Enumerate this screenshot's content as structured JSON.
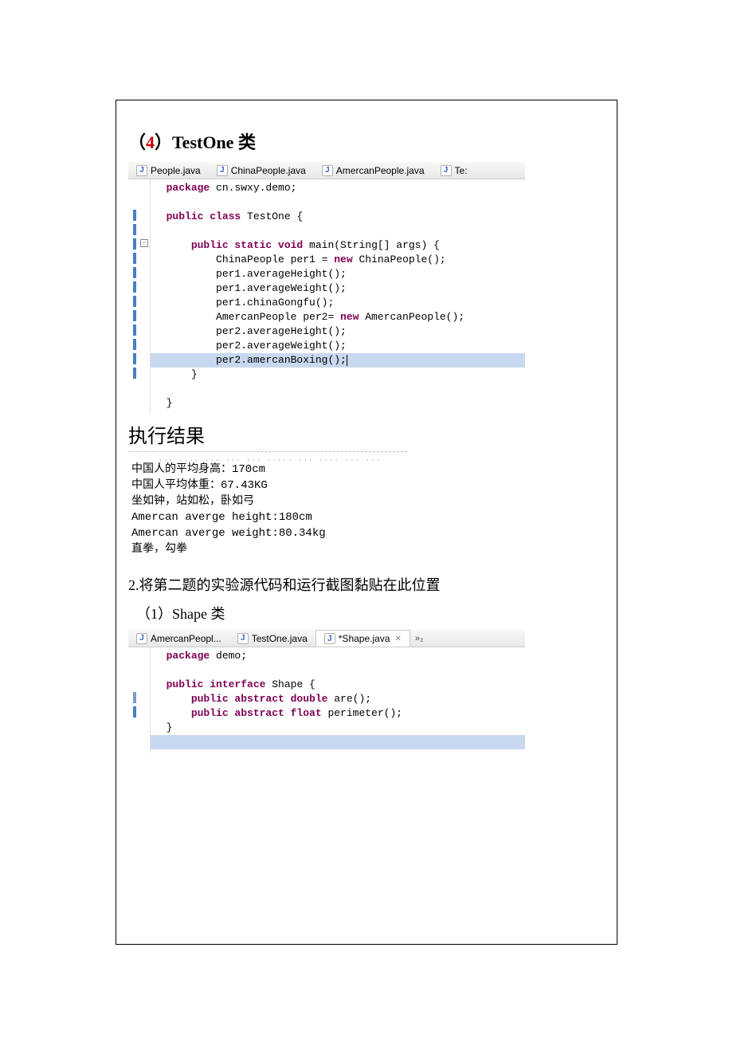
{
  "section4": {
    "title_paren_open": "（",
    "title_num": "4",
    "title_paren_close": "）",
    "title_name": "TestOne",
    "title_class_word": " 类"
  },
  "tabs1": [
    {
      "label": "People.java",
      "active": false
    },
    {
      "label": "ChinaPeople.java",
      "active": false
    },
    {
      "label": "AmercanPeople.java",
      "active": false
    },
    {
      "label": "Te:",
      "active": false
    }
  ],
  "code1_lines": [
    {
      "indent": "  ",
      "tokens": [
        {
          "t": "kw",
          "v": "package"
        },
        {
          "t": "plain",
          "v": " cn.swxy.demo;"
        }
      ],
      "gutter": {}
    },
    {
      "indent": "",
      "tokens": [],
      "gutter": {}
    },
    {
      "indent": "  ",
      "tokens": [
        {
          "t": "kw",
          "v": "public class"
        },
        {
          "t": "plain",
          "v": " TestOne {"
        }
      ],
      "gutter": {
        "bar": "blue"
      }
    },
    {
      "indent": "",
      "tokens": [],
      "gutter": {
        "bar": "blue"
      }
    },
    {
      "indent": "      ",
      "tokens": [
        {
          "t": "kw",
          "v": "public static void"
        },
        {
          "t": "plain",
          "v": " main(String[] args) {"
        }
      ],
      "gutter": {
        "bar": "blue",
        "collapse": "-"
      }
    },
    {
      "indent": "          ",
      "tokens": [
        {
          "t": "plain",
          "v": "ChinaPeople per1 = "
        },
        {
          "t": "kw",
          "v": "new"
        },
        {
          "t": "plain",
          "v": " ChinaPeople();"
        }
      ],
      "gutter": {
        "bar": "blue"
      }
    },
    {
      "indent": "          ",
      "tokens": [
        {
          "t": "plain",
          "v": "per1.averageHeight();"
        }
      ],
      "gutter": {
        "bar": "blue"
      }
    },
    {
      "indent": "          ",
      "tokens": [
        {
          "t": "plain",
          "v": "per1.averageWeight();"
        }
      ],
      "gutter": {
        "bar": "blue"
      }
    },
    {
      "indent": "          ",
      "tokens": [
        {
          "t": "plain",
          "v": "per1.chinaGongfu();"
        }
      ],
      "gutter": {
        "bar": "blue"
      }
    },
    {
      "indent": "          ",
      "tokens": [
        {
          "t": "plain",
          "v": "AmercanPeople per2= "
        },
        {
          "t": "kw",
          "v": "new"
        },
        {
          "t": "plain",
          "v": " AmercanPeople();"
        }
      ],
      "gutter": {
        "bar": "blue"
      }
    },
    {
      "indent": "          ",
      "tokens": [
        {
          "t": "plain",
          "v": "per2.averageHeight();"
        }
      ],
      "gutter": {
        "bar": "blue"
      }
    },
    {
      "indent": "          ",
      "tokens": [
        {
          "t": "plain",
          "v": "per2.averageWeight();"
        }
      ],
      "gutter": {
        "bar": "blue"
      }
    },
    {
      "indent": "          ",
      "tokens": [
        {
          "t": "plain",
          "v": "per2.amercanBoxing();"
        }
      ],
      "gutter": {
        "bar": "blue"
      },
      "hl": true,
      "cursor": true
    },
    {
      "indent": "      ",
      "tokens": [
        {
          "t": "plain",
          "v": "}"
        }
      ],
      "gutter": {
        "bar": "blue"
      }
    },
    {
      "indent": "",
      "tokens": [],
      "gutter": {}
    },
    {
      "indent": "  ",
      "tokens": [
        {
          "t": "plain",
          "v": "}"
        }
      ],
      "gutter": {}
    }
  ],
  "result_heading": "执行结果",
  "console_lines": [
    "中国人的平均身高：170cm",
    "中国人平均体重：67.43KG",
    "坐如钟，站如松，卧如弓",
    "Amercan averge height:180cm",
    "Amercan averge weight:80.34kg",
    "直拳，勾拳"
  ],
  "q2_text": "2.将第二题的实验源代码和运行截图黏贴在此位置",
  "sub1": "（1）Shape 类",
  "tabs2": [
    {
      "label": "AmercanPeopl...",
      "active": false
    },
    {
      "label": "TestOne.java",
      "active": false
    },
    {
      "label": "*Shape.java",
      "active": true,
      "close": true
    }
  ],
  "overflow2": "»₂",
  "code2_lines": [
    {
      "indent": "  ",
      "tokens": [
        {
          "t": "kw",
          "v": "package"
        },
        {
          "t": "plain",
          "v": " demo;"
        }
      ],
      "gutter": {}
    },
    {
      "indent": "",
      "tokens": [],
      "gutter": {}
    },
    {
      "indent": "  ",
      "tokens": [
        {
          "t": "kw",
          "v": "public interface"
        },
        {
          "t": "plain",
          "v": " Shape {"
        }
      ],
      "gutter": {}
    },
    {
      "indent": "      ",
      "tokens": [
        {
          "t": "kw",
          "v": "public abstract double"
        },
        {
          "t": "plain",
          "v": " are();"
        }
      ],
      "gutter": {
        "bar": "std"
      }
    },
    {
      "indent": "      ",
      "tokens": [
        {
          "t": "kw",
          "v": "public abstract float"
        },
        {
          "t": "plain",
          "v": " perimeter();"
        }
      ],
      "gutter": {
        "bar": "blue"
      }
    },
    {
      "indent": "  ",
      "tokens": [
        {
          "t": "plain",
          "v": "}"
        }
      ],
      "gutter": {}
    },
    {
      "indent": "",
      "tokens": [],
      "gutter": {},
      "hl": true
    }
  ]
}
